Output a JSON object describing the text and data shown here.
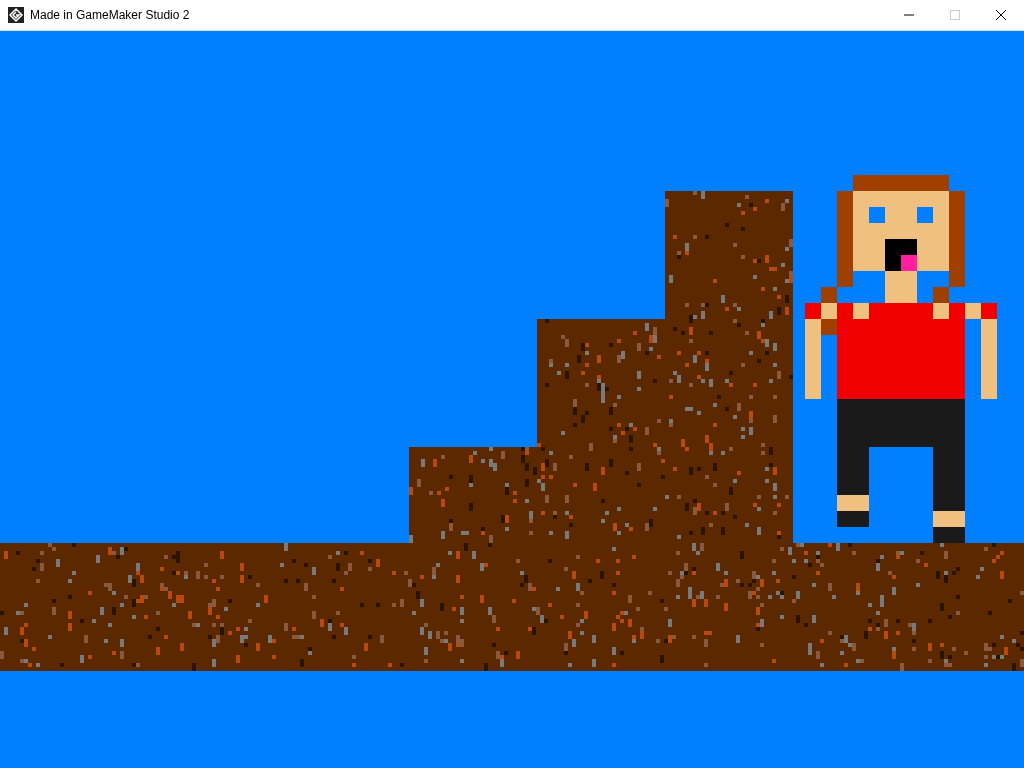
{
  "window": {
    "title": "Made in GameMaker Studio 2",
    "maximize_disabled": true
  }
}
